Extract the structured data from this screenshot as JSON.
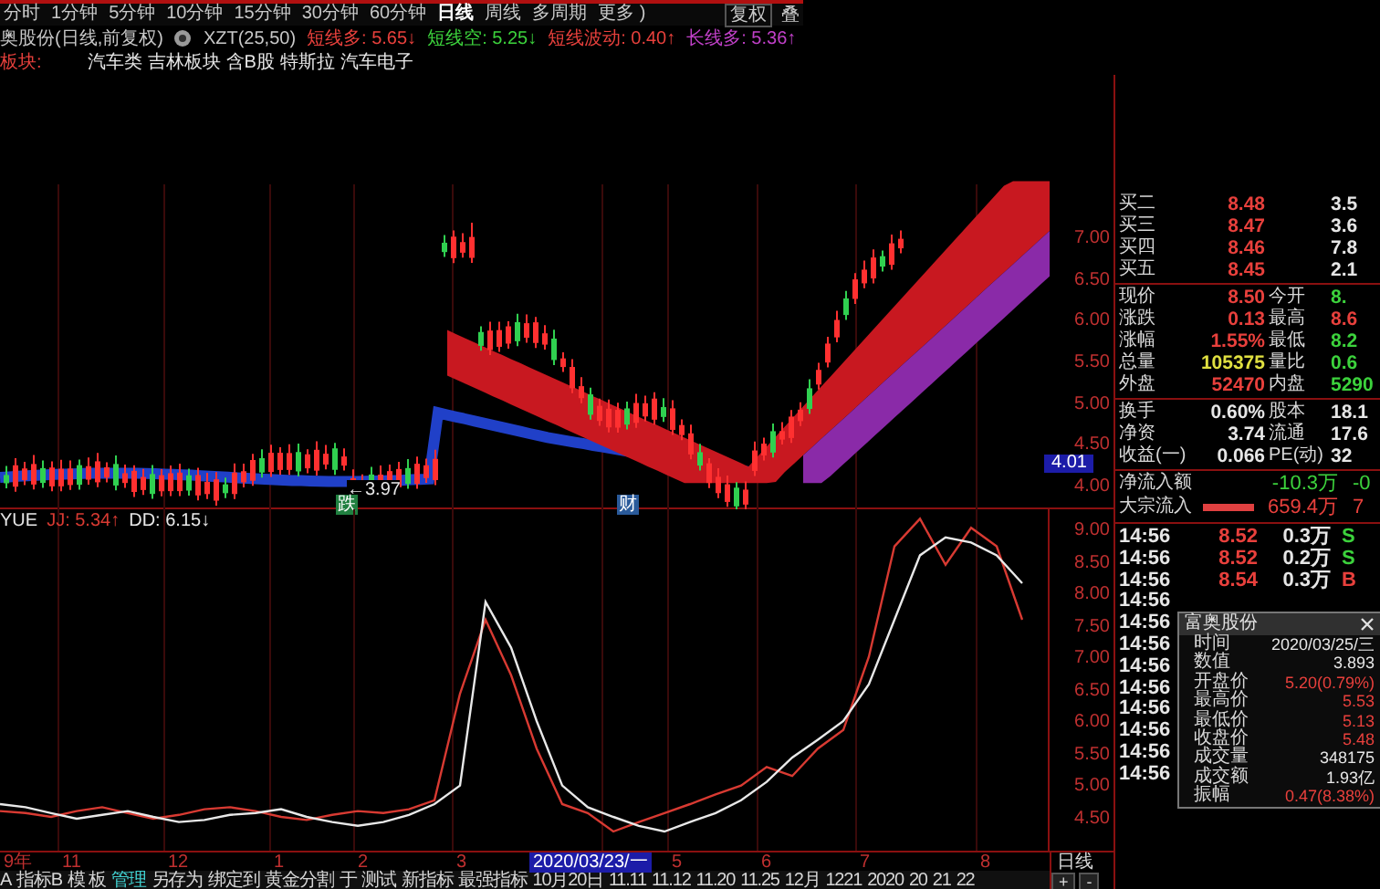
{
  "period_bar": {
    "tabs": [
      {
        "label": "分时",
        "selected": false
      },
      {
        "label": "1分钟",
        "selected": false
      },
      {
        "label": "5分钟",
        "selected": false
      },
      {
        "label": "10分钟",
        "selected": false
      },
      {
        "label": "15分钟",
        "selected": false
      },
      {
        "label": "30分钟",
        "selected": false
      },
      {
        "label": "60分钟",
        "selected": false
      },
      {
        "label": "日线",
        "selected": true
      },
      {
        "label": "周线",
        "selected": false
      },
      {
        "label": "多周期",
        "selected": false
      },
      {
        "label": "更多 )",
        "selected": false
      }
    ],
    "right_buttons": [
      "复权",
      "叠"
    ]
  },
  "info_line": {
    "title": "奥股份(日线,前复权)",
    "indicator": "XZT(25,50)",
    "values": [
      {
        "text": "短线多: 5.65↓",
        "color": "#e8403c"
      },
      {
        "text": "短线空: 5.25↓",
        "color": "#3cd23c"
      },
      {
        "text": "短线波动: 0.40↑",
        "color": "#e8403c"
      },
      {
        "text": "长线多: 5.36↑",
        "color": "#c040c8"
      }
    ]
  },
  "concept_line": {
    "label": "板块:",
    "tags": [
      "汽车类",
      "吉林板块",
      "含B股",
      "特斯拉",
      "汽车电子"
    ]
  },
  "main_chart": {
    "price_labels": [
      "7.00",
      "6.50",
      "6.00",
      "5.50",
      "5.00",
      "4.50",
      "4.00"
    ],
    "current_price": "4.01",
    "annotations": [
      {
        "text": "←3.97",
        "kind": "note"
      },
      {
        "text": "跌",
        "kind": "green_tag"
      },
      {
        "text": "财",
        "kind": "blue_tag"
      }
    ]
  },
  "lower_chart": {
    "legend_title": "YUE",
    "readings": [
      ": 5.34↑",
      ": 6.15↓"
    ],
    "chart_data": {
      "type": "line",
      "ylim": [
        4.0,
        9.35
      ],
      "yticks": [
        {
          "value": 9,
          "label": "9.00"
        },
        {
          "value": 8.5,
          "label": "8.50"
        },
        {
          "value": 8,
          "label": "8.00"
        },
        {
          "value": 7.5,
          "label": "7.50"
        },
        {
          "value": 7,
          "label": "7.00"
        },
        {
          "value": 6.5,
          "label": "6.50"
        },
        {
          "value": 6,
          "label": "6.00"
        },
        {
          "value": 5.5,
          "label": "5.50"
        },
        {
          "value": 5,
          "label": "5.00"
        },
        {
          "value": 4.5,
          "label": "4.50"
        }
      ],
      "series": [
        {
          "name": "JJ",
          "color": "#d83a32",
          "values": [
            4.62,
            4.59,
            4.53,
            4.62,
            4.68,
            4.59,
            4.5,
            4.56,
            4.65,
            4.68,
            4.62,
            4.53,
            4.48,
            4.56,
            4.62,
            4.59,
            4.65,
            4.79,
            6.46,
            7.62,
            6.75,
            5.6,
            4.73,
            4.59,
            4.3,
            4.45,
            4.59,
            4.73,
            4.88,
            5.02,
            5.31,
            5.17,
            5.6,
            5.89,
            7.04,
            8.77,
            9.2,
            8.48,
            9.06,
            8.77,
            7.62
          ]
        },
        {
          "name": "DD",
          "color": "#e8e8e8",
          "values": [
            4.73,
            4.68,
            4.59,
            4.5,
            4.56,
            4.62,
            4.53,
            4.45,
            4.48,
            4.56,
            4.59,
            4.65,
            4.53,
            4.45,
            4.39,
            4.45,
            4.56,
            4.73,
            5.02,
            7.9,
            7.18,
            6.03,
            5.02,
            4.68,
            4.53,
            4.39,
            4.3,
            4.45,
            4.59,
            4.79,
            5.08,
            5.46,
            5.74,
            6.03,
            6.61,
            7.62,
            8.63,
            8.91,
            8.83,
            8.63,
            8.19
          ]
        }
      ]
    }
  },
  "date_axis": {
    "labels": [
      {
        "text": "9年",
        "selected": false
      },
      {
        "text": "11",
        "selected": false
      },
      {
        "text": "12",
        "selected": false
      },
      {
        "text": "1",
        "selected": false
      },
      {
        "text": "2",
        "selected": false
      },
      {
        "text": "3",
        "selected": false
      },
      {
        "text": "2020/03/23/一",
        "selected": true
      },
      {
        "text": "5",
        "selected": false
      },
      {
        "text": "6",
        "selected": false
      },
      {
        "text": "7",
        "selected": false
      },
      {
        "text": "8",
        "selected": false
      }
    ]
  },
  "bottom_tabs": [
    {
      "label": "A",
      "selected": false
    },
    {
      "label": "指标B",
      "selected": false
    },
    {
      "label": "模 板",
      "selected": false
    },
    {
      "label": "管理",
      "selected": true
    },
    {
      "label": "另存为",
      "selected": false
    },
    {
      "label": "绑定到",
      "selected": false
    },
    {
      "label": "黄金分割",
      "selected": false
    },
    {
      "label": "于",
      "selected": false
    },
    {
      "label": "测试",
      "selected": false
    },
    {
      "label": "新指标",
      "selected": false
    },
    {
      "label": "最强指标",
      "selected": false
    },
    {
      "label": "10月20日",
      "selected": false
    },
    {
      "label": "11.11",
      "selected": false
    },
    {
      "label": "11.12",
      "selected": false
    },
    {
      "label": "11.20",
      "selected": false
    },
    {
      "label": "11.25",
      "selected": false
    },
    {
      "label": "12月",
      "selected": false
    },
    {
      "label": "1221",
      "selected": false
    },
    {
      "label": "2020",
      "selected": false
    },
    {
      "label": "20",
      "selected": false
    },
    {
      "label": "21",
      "selected": false
    },
    {
      "label": "22",
      "selected": false
    }
  ],
  "corner": {
    "period": "日线",
    "zoom_buttons": [
      "+",
      "-"
    ]
  },
  "quote_panel": {
    "order_book": [
      {
        "label": "买二",
        "price": "8.48",
        "volume": "3.5"
      },
      {
        "label": "买三",
        "price": "8.47",
        "volume": "3.6"
      },
      {
        "label": "买四",
        "price": "8.46",
        "volume": "7.8"
      },
      {
        "label": "买五",
        "price": "8.45",
        "volume": "2.1"
      }
    ],
    "stat_groups": [
      [
        {
          "cells": [
            {
              "label": "现价",
              "value": "8.50",
              "color": "#e8403c"
            },
            {
              "label": "今开",
              "value": "8.",
              "color": "#3cd23c"
            }
          ]
        },
        {
          "cells": [
            {
              "label": "涨跌",
              "value": "0.13",
              "color": "#e8403c"
            },
            {
              "label": "最高",
              "value": "8.6",
              "color": "#e8403c"
            }
          ]
        },
        {
          "cells": [
            {
              "label": "涨幅",
              "value": "1.55%",
              "color": "#e8403c"
            },
            {
              "label": "最低",
              "value": "8.2",
              "color": "#3cd23c"
            }
          ]
        },
        {
          "cells": [
            {
              "label": "总量",
              "value": "105375",
              "color": "#e0e040"
            },
            {
              "label": "量比",
              "value": "0.6",
              "color": "#3cd23c"
            }
          ]
        },
        {
          "cells": [
            {
              "label": "外盘",
              "value": "52470",
              "color": "#e8403c"
            },
            {
              "label": "内盘",
              "value": "5290",
              "color": "#3cd23c"
            }
          ]
        }
      ],
      [
        {
          "cells": [
            {
              "label": "换手",
              "value": "0.60%",
              "color": "#e6e6e6"
            },
            {
              "label": "股本",
              "value": "18.1",
              "color": "#e6e6e6"
            }
          ]
        },
        {
          "cells": [
            {
              "label": "净资",
              "value": "3.74",
              "color": "#e6e6e6"
            },
            {
              "label": "流通",
              "value": "17.6",
              "color": "#e6e6e6"
            }
          ]
        },
        {
          "cells": [
            {
              "label": "收益(一)",
              "value": "0.066",
              "color": "#e6e6e6"
            },
            {
              "label": "PE(动)",
              "value": "32",
              "color": "#e6e6e6"
            }
          ]
        }
      ]
    ],
    "flows": [
      {
        "label": "净流入额",
        "kind": "plain",
        "value": "-10.3万",
        "value2": "-0",
        "color": "#3cd23c"
      },
      {
        "label": "大宗流入",
        "kind": "bar",
        "value": "659.4万",
        "value2": "7",
        "color": "#e8403c"
      }
    ],
    "trades": [
      {
        "time": "14:56",
        "price": "8.52",
        "volume": "0.3万",
        "side": "S"
      },
      {
        "time": "14:56",
        "price": "8.52",
        "volume": "0.2万",
        "side": "S"
      },
      {
        "time": "14:56",
        "price": "8.54",
        "volume": "0.3万",
        "side": "B"
      },
      {
        "time": "14:56"
      },
      {
        "time": "14:56"
      },
      {
        "time": "14:56"
      },
      {
        "time": "14:56"
      },
      {
        "time": "14:56"
      },
      {
        "time": "14:56"
      },
      {
        "time": "14:56"
      },
      {
        "time": "14:56"
      },
      {
        "time": "14:56"
      }
    ]
  },
  "popup": {
    "title": "富奥股份",
    "rows": [
      {
        "label": "时间",
        "value": "2020/03/25/三",
        "color": "#e6e6e6"
      },
      {
        "label": "数值",
        "value": "3.893",
        "color": "#e6e6e6"
      },
      {
        "label": "开盘价",
        "value": "5.20(0.79%)",
        "color": "#e8403c"
      },
      {
        "label": "最高价",
        "value": "5.53",
        "color": "#e8403c"
      },
      {
        "label": "最低价",
        "value": "5.13",
        "color": "#e8403c"
      },
      {
        "label": "收盘价",
        "value": "5.48",
        "color": "#e8403c"
      },
      {
        "label": "成交量",
        "value": "348175",
        "color": "#e6e6e6"
      },
      {
        "label": "成交额",
        "value": "1.93亿",
        "color": "#e6e6e6"
      },
      {
        "label": "振幅",
        "value": "0.47(8.38%)",
        "color": "#e8403c"
      }
    ]
  }
}
